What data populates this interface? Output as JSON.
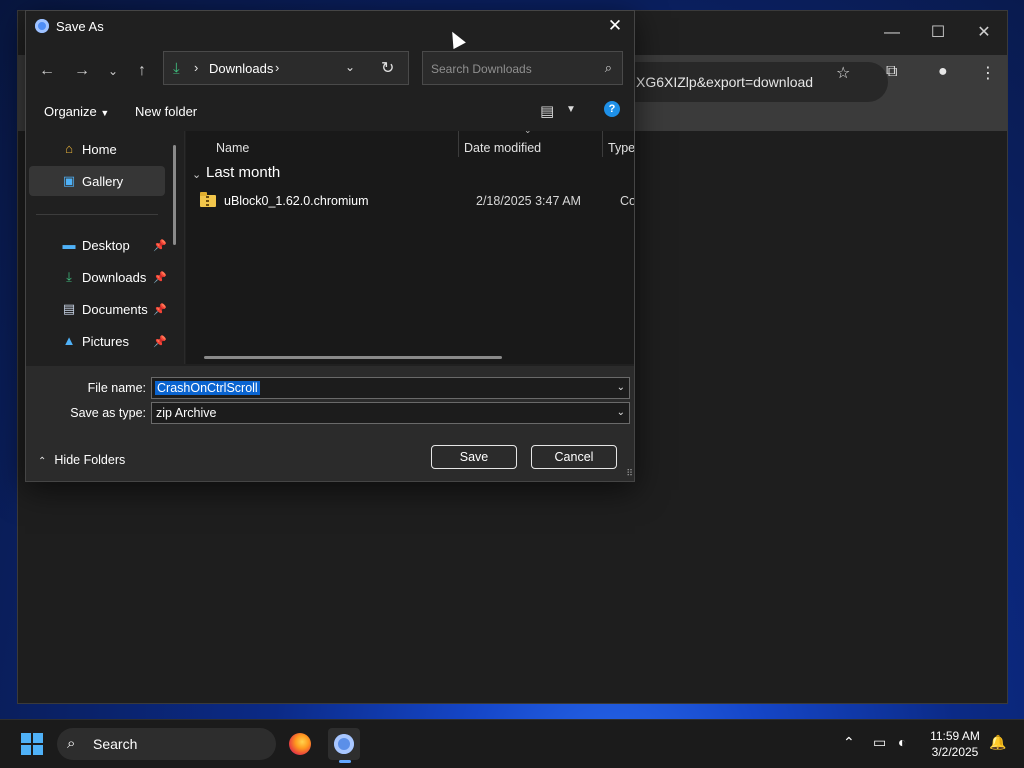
{
  "browser": {
    "url_fragment": "XG6XIZlp&export=download",
    "window_controls": {
      "minimize": "—",
      "maximize": "☐",
      "close": "✕"
    }
  },
  "dialog": {
    "title": "Save As",
    "address": {
      "location": "Downloads"
    },
    "search": {
      "placeholder": "Search Downloads"
    },
    "commands": {
      "organize": "Organize",
      "new_folder": "New folder"
    },
    "nav": {
      "items": [
        {
          "label": "Home",
          "icon": "home-icon",
          "pinned": false,
          "selected": false
        },
        {
          "label": "Gallery",
          "icon": "gallery-icon",
          "pinned": false,
          "selected": true
        },
        {
          "label": "Desktop",
          "icon": "desktop-icon",
          "pinned": true,
          "selected": false
        },
        {
          "label": "Downloads",
          "icon": "download-icon",
          "pinned": true,
          "selected": false
        },
        {
          "label": "Documents",
          "icon": "document-icon",
          "pinned": true,
          "selected": false
        },
        {
          "label": "Pictures",
          "icon": "pictures-icon",
          "pinned": true,
          "selected": false
        }
      ]
    },
    "columns": {
      "name": "Name",
      "date_modified": "Date modified",
      "type": "Type"
    },
    "groups": [
      {
        "title": "Last month",
        "files": [
          {
            "name": "uBlock0_1.62.0.chromium",
            "date": "2/18/2025 3:47 AM",
            "type": "Com"
          }
        ]
      }
    ],
    "file_name_label": "File name:",
    "file_name_value": "CrashOnCtrlScroll",
    "save_type_label": "Save as type:",
    "save_type_value": "zip Archive",
    "hide_folders": "Hide Folders",
    "save_button": "Save",
    "cancel_button": "Cancel"
  },
  "taskbar": {
    "search_label": "Search",
    "clock_time": "11:59 AM",
    "clock_date": "3/2/2025"
  },
  "colors": {
    "accent": "#0a64d0",
    "dialog_bg": "#202020",
    "bottom_bg": "#2b2b2b"
  }
}
